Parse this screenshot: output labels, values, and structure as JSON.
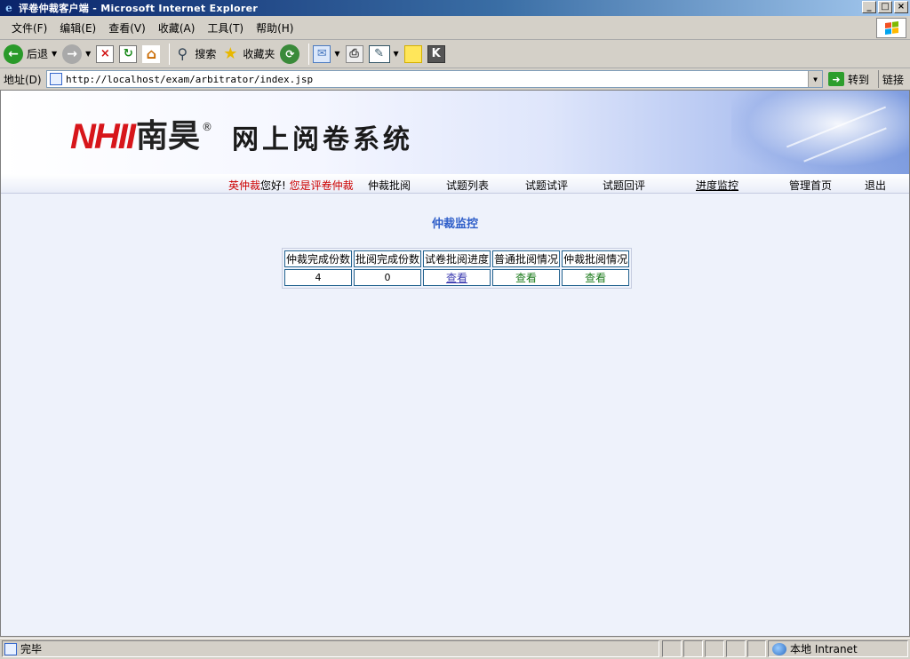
{
  "window": {
    "title": "评卷仲裁客户端 - Microsoft Internet Explorer",
    "controls": {
      "minimize": "_",
      "maximize": "□",
      "close": "×"
    }
  },
  "menubar": {
    "items": [
      "文件(F)",
      "编辑(E)",
      "查看(V)",
      "收藏(A)",
      "工具(T)",
      "帮助(H)"
    ]
  },
  "toolbar": {
    "back_label": "后退",
    "search_label": "搜索",
    "favorites_label": "收藏夹"
  },
  "addressbar": {
    "label": "地址(D)",
    "url": "http://localhost/exam/arbitrator/index.jsp",
    "go_label": "转到",
    "links_label": "链接"
  },
  "banner": {
    "logo_latin": "NHII",
    "logo_name": "南昊",
    "logo_reg": "®",
    "system_title": "网上阅卷系统"
  },
  "nav": {
    "user_name": "英仲裁",
    "greeting": "您好!",
    "role_text": "您是评卷仲裁",
    "links": [
      "仲裁批阅",
      "试题列表",
      "试题试评",
      "试题回评",
      "进度监控",
      "管理首页",
      "退出"
    ],
    "active": "进度监控"
  },
  "page": {
    "section_title": "仲裁监控",
    "table": {
      "headers": [
        "仲裁完成份数",
        "批阅完成份数",
        "试卷批阅进度",
        "普通批阅情况",
        "仲裁批阅情况"
      ],
      "row": {
        "arbitration_done": "4",
        "review_done": "0",
        "progress_link": "查看",
        "normal_link": "查看",
        "arbitration_link": "查看"
      }
    }
  },
  "statusbar": {
    "status_text": "完毕",
    "zone_text": "本地 Intranet"
  },
  "colors": {
    "titlebar_start": "#0a246a",
    "accent_blue": "#2e5ec9",
    "brand_red": "#d7161b",
    "greeting_red": "#cc0000",
    "link_green": "#1a7a1a",
    "page_bg": "#eef2fb"
  }
}
